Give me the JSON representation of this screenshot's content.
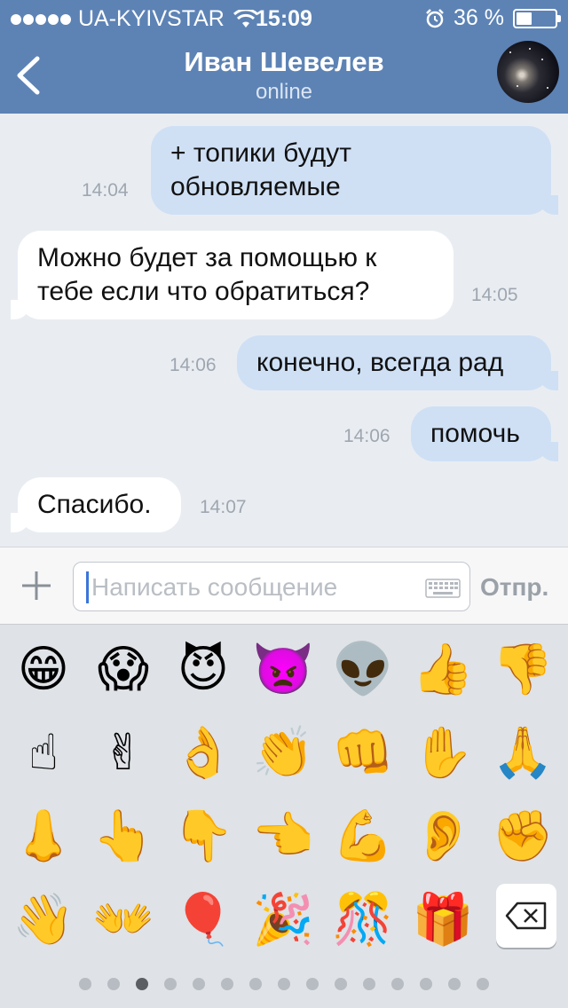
{
  "status_bar": {
    "carrier": "UA-KYIVSTAR",
    "time": "15:09",
    "battery_text": "36 %",
    "battery_level": 0.36
  },
  "header": {
    "title": "Иван Шевелев",
    "subtitle": "online",
    "back_icon": "chevron-left-icon",
    "avatar_icon": "avatar"
  },
  "messages": [
    {
      "direction": "outgoing",
      "lines": [
        "+ топики будут",
        "обновляемые"
      ],
      "time": "14:04"
    },
    {
      "direction": "incoming",
      "lines": [
        "Можно будет за помощью к",
        "тебе если что обратиться?"
      ],
      "time": "14:05"
    },
    {
      "direction": "outgoing",
      "lines": [
        "конечно, всегда рад"
      ],
      "time": "14:06"
    },
    {
      "direction": "outgoing",
      "lines": [
        "помочь"
      ],
      "time": "14:06"
    },
    {
      "direction": "incoming",
      "lines": [
        "Спасибо."
      ],
      "time": "14:07"
    }
  ],
  "composer": {
    "attach_icon": "plus-icon",
    "placeholder": "Написать сообщение",
    "keyboard_icon": "keyboard-icon",
    "send_label": "Отпр."
  },
  "emoji_keyboard": {
    "emojis": [
      {
        "char": "😁",
        "name": "grinning-face"
      },
      {
        "char": "😱",
        "name": "screaming-face"
      },
      {
        "char": "😈",
        "name": "smiling-devil"
      },
      {
        "char": "👿",
        "name": "angry-devil"
      },
      {
        "char": "👽",
        "name": "alien"
      },
      {
        "char": "👍",
        "name": "thumbs-up"
      },
      {
        "char": "👎",
        "name": "thumbs-down"
      },
      {
        "char": "☝",
        "name": "index-pointing-up"
      },
      {
        "char": "✌",
        "name": "victory-hand"
      },
      {
        "char": "👌",
        "name": "ok-hand"
      },
      {
        "char": "👏",
        "name": "clapping-hands"
      },
      {
        "char": "👊",
        "name": "fist-bump"
      },
      {
        "char": "✋",
        "name": "raised-hand"
      },
      {
        "char": "🙏",
        "name": "folded-hands"
      },
      {
        "char": "👃",
        "name": "nose"
      },
      {
        "char": "👆",
        "name": "backhand-pointing-up"
      },
      {
        "char": "👇",
        "name": "backhand-pointing-down"
      },
      {
        "char": "👈",
        "name": "backhand-pointing-left"
      },
      {
        "char": "💪",
        "name": "flexed-biceps"
      },
      {
        "char": "👂",
        "name": "ear"
      },
      {
        "char": "✊",
        "name": "raised-fist"
      },
      {
        "char": "👋",
        "name": "waving-hand"
      },
      {
        "char": "👐",
        "name": "open-hands"
      },
      {
        "char": "🎈",
        "name": "balloon"
      },
      {
        "char": "🎉",
        "name": "party-popper"
      },
      {
        "char": "🎊",
        "name": "confetti-ball"
      },
      {
        "char": "🎁",
        "name": "wrapped-gift"
      }
    ],
    "delete_icon": "backspace-icon",
    "page_count": 15,
    "active_page": 3
  }
}
